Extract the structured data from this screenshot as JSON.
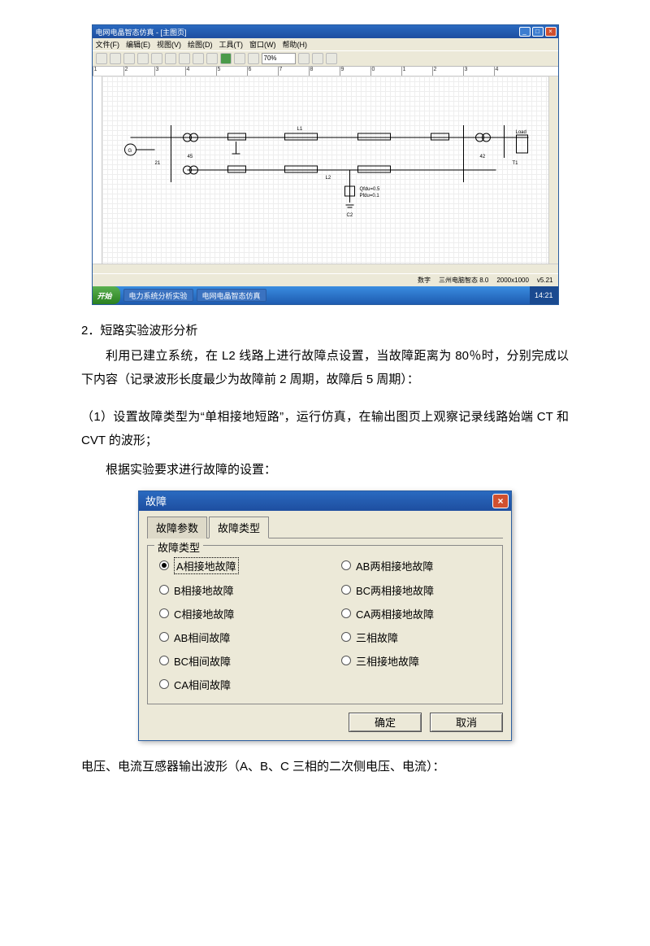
{
  "sim": {
    "title": "电网电晶智态仿真 - [主图页]",
    "menus": [
      "文件(F)",
      "编辑(E)",
      "视图(V)",
      "绘图(D)",
      "工具(T)",
      "窗口(W)",
      "帮助(H)"
    ],
    "zoom": "70%",
    "ruler_marks": [
      "1",
      "2",
      "3",
      "4",
      "5",
      "6",
      "7",
      "8",
      "9",
      "0",
      "1",
      "2",
      "3",
      "4"
    ],
    "status_num": "数字",
    "status_app": "三州电脑智态 8.0",
    "status_res": "2000x1000",
    "status_ver": "v5.21"
  },
  "circuit": {
    "labels": [
      "G",
      "45",
      "21",
      "L1",
      "L2",
      "42",
      "T1",
      "Load",
      "Qfdu-0.5",
      "Pfdu=0.1",
      "C2"
    ]
  },
  "taskbar": {
    "start": "开始",
    "items": [
      "电力系统分析实验",
      "电网电晶智态仿真"
    ],
    "time": "14:21"
  },
  "text": {
    "sec2": "2．短路实验波形分析",
    "p1": "利用已建立系统，在 L2 线路上进行故障点设置，当故障距离为 80％时，分别完成以下内容（记录波形长度最少为故障前 2 周期，故障后 5 周期）：",
    "p2": "（1）设置故障类型为“单相接地短路”，运行仿真，在输出图页上观察记录线路始端 CT 和 CVT 的波形；",
    "p3": "根据实验要求进行故障的设置：",
    "p4": "电压、电流互感器输出波形（A、B、C 三相的二次侧电压、电流）："
  },
  "dlg": {
    "title": "故障",
    "tabs": [
      "故障参数",
      "故障类型"
    ],
    "group_title": "故障类型",
    "radios_left": [
      "A相接地故障",
      "B相接地故障",
      "C相接地故障",
      "AB相间故障",
      "BC相间故障",
      "CA相间故障"
    ],
    "radios_right": [
      "AB两相接地故障",
      "BC两相接地故障",
      "CA两相接地故障",
      "三相故障",
      "三相接地故障"
    ],
    "selected": "A相接地故障",
    "ok": "确定",
    "cancel": "取消"
  }
}
